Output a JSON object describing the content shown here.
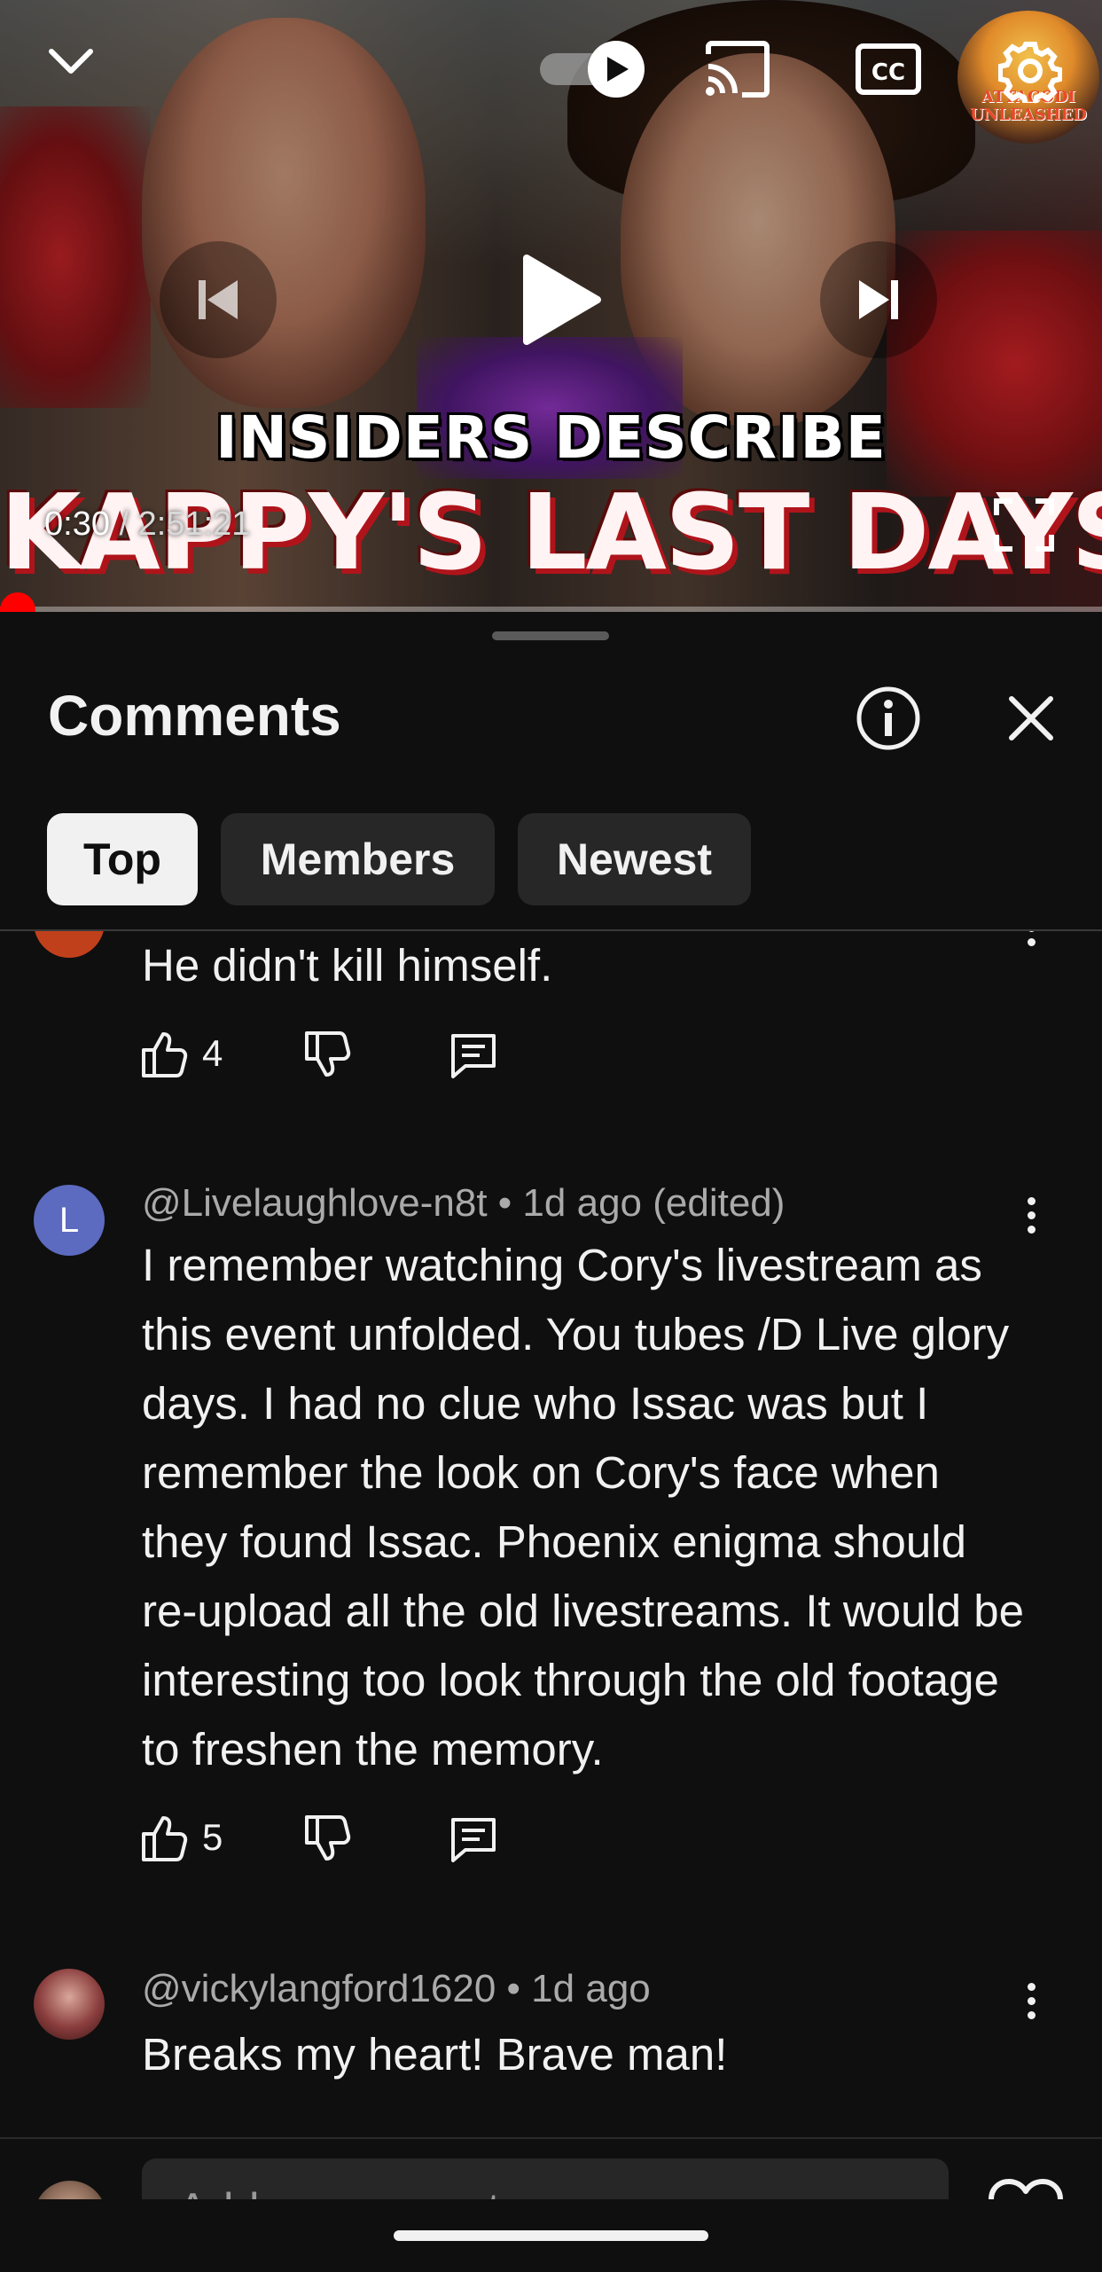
{
  "player": {
    "headline_line1": "INSIDERS DESCRIBE",
    "headline_line2": "KAPPY'S LAST DAYS!",
    "current_time": "0:30",
    "separator": " / ",
    "duration": "2:51:21",
    "badge_text": "ATTACODI UNLEASHED",
    "progress_fraction": 0.003,
    "autoplay_state": "on"
  },
  "comments_panel": {
    "title": "Comments",
    "tabs": [
      {
        "label": "Top",
        "active": true
      },
      {
        "label": "Members",
        "active": false
      },
      {
        "label": "Newest",
        "active": false
      }
    ]
  },
  "comments": [
    {
      "author": "",
      "meta": "",
      "text": "He didn't kill himself.",
      "likes": "4",
      "avatar_letter": "",
      "avatar_color": "#c1401c"
    },
    {
      "author": "@Livelaughlove-n8t",
      "meta": "@Livelaughlove-n8t • 1d ago (edited)",
      "text": "I remember watching Cory's livestream as this event unfolded. You tubes /D Live glory days. I had no clue who Issac was but I remember the look on Cory's face when they found Issac.  Phoenix enigma should re-upload all the old livestreams. It would be interesting too look through the old footage to freshen the memory.",
      "likes": "5",
      "avatar_letter": "L",
      "avatar_color": "#5c6bc0"
    },
    {
      "author": "@vickylangford1620",
      "meta": "@vickylangford1620 • 1d ago",
      "text": "Breaks my heart! Brave man!",
      "likes": "",
      "avatar_letter": "",
      "avatar_color": "#7a3b3b"
    }
  ],
  "composer": {
    "placeholder": "Add a comment..."
  },
  "colors": {
    "background": "#0f0f0f",
    "chip": "#272727",
    "chip_active": "#f1f1f1",
    "progress": "#ff0000",
    "meta_text": "#aaaaaa"
  }
}
